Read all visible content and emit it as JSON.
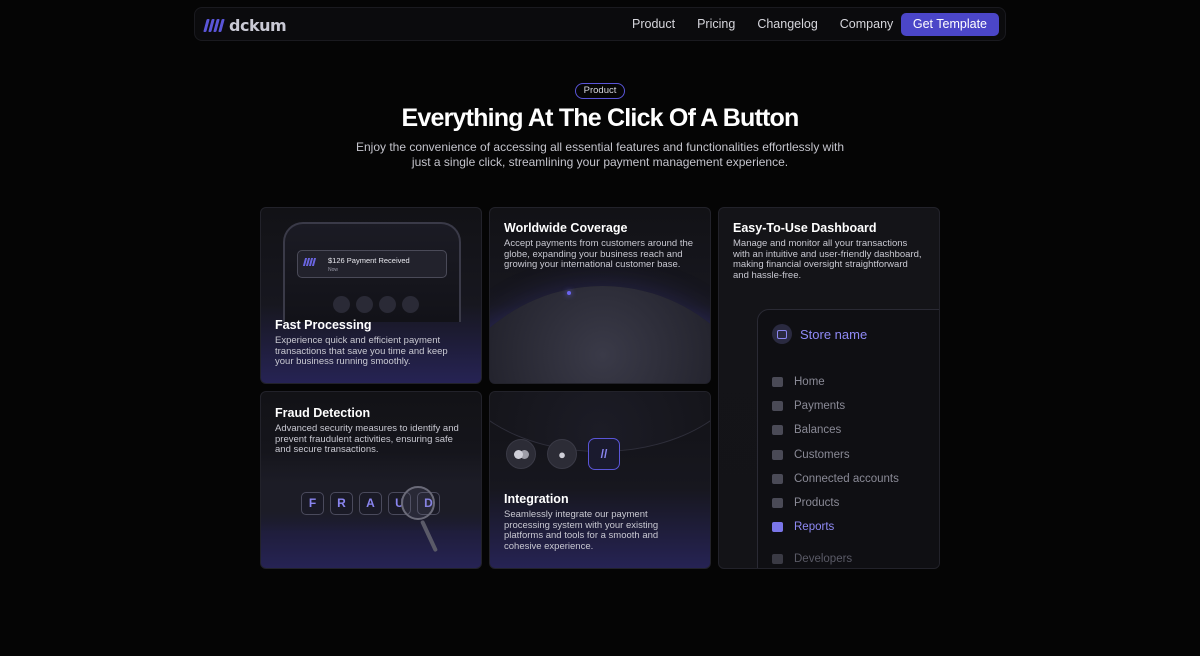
{
  "nav": {
    "logo_text": "dckum",
    "links": [
      "Product",
      "Pricing",
      "Changelog",
      "Company"
    ],
    "cta_label": "Get Template"
  },
  "hero": {
    "badge": "Product",
    "title": "Everything At The Click Of A Button",
    "subtitle": "Enjoy the convenience of accessing all essential features and functionalities effortlessly with just a single click, streamlining your payment management experience."
  },
  "cards": {
    "fast": {
      "title": "Fast Processing",
      "body": "Experience quick and efficient payment transactions that save you time and keep your business running smoothly.",
      "notification_title": "$126 Payment Received",
      "notification_time": "Now"
    },
    "world": {
      "title": "Worldwide Coverage",
      "body": "Accept payments from customers around the globe, expanding your business reach and growing your international customer base."
    },
    "dashboard": {
      "title": "Easy-To-Use Dashboard",
      "body": "Manage and monitor all your transactions with an intuitive and user-friendly dashboard, making financial oversight straightforward and hassle-free.",
      "store_name": "Store name",
      "menu": [
        {
          "label": "Home",
          "icon": "home-icon"
        },
        {
          "label": "Payments",
          "icon": "payments-icon"
        },
        {
          "label": "Balances",
          "icon": "balances-icon"
        },
        {
          "label": "Customers",
          "icon": "customers-icon"
        },
        {
          "label": "Connected accounts",
          "icon": "globe-icon"
        },
        {
          "label": "Products",
          "icon": "box-icon"
        },
        {
          "label": "Reports",
          "icon": "reports-icon",
          "active": true
        }
      ],
      "developers_label": "Developers"
    },
    "fraud": {
      "title": "Fraud Detection",
      "body": "Advanced security measures to identify and prevent fraudulent activities, ensuring safe and secure transactions.",
      "keys": [
        "F",
        "R",
        "A",
        "U",
        "D"
      ]
    },
    "integration": {
      "title": "Integration",
      "body": "Seamlessly integrate our payment processing system with your existing platforms and tools for a smooth and cohesive experience."
    }
  },
  "colors": {
    "accent": "#4b46c8",
    "accent_text": "#8f8af5",
    "background": "#050505"
  }
}
